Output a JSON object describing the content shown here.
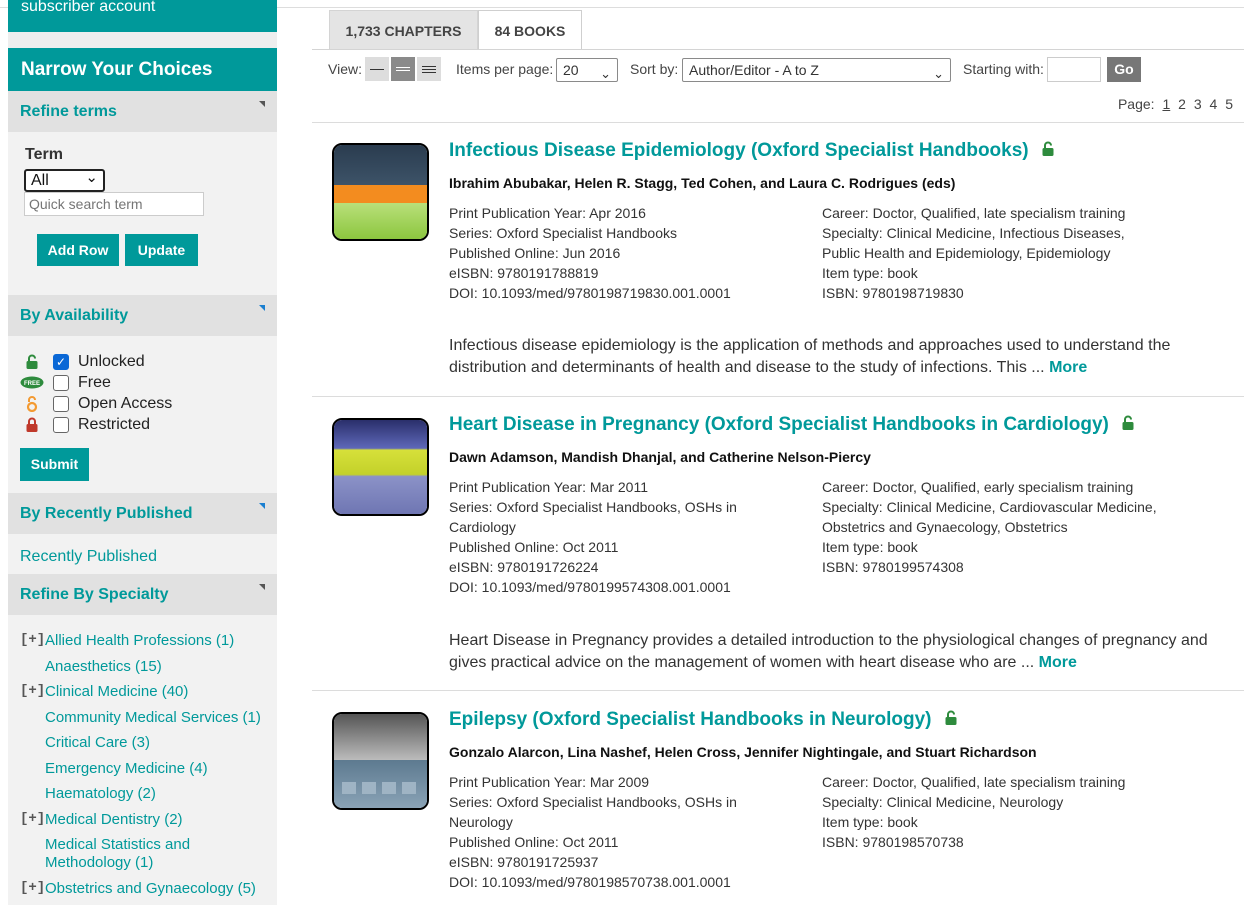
{
  "sidebar": {
    "subscriber_text": "subscriber account",
    "narrow_title": "Narrow Your Choices",
    "refine_terms": {
      "title": "Refine terms",
      "term_label": "Term",
      "term_value": "All",
      "search_placeholder": "Quick search term",
      "add_row": "Add Row",
      "update": "Update"
    },
    "availability": {
      "title": "By Availability",
      "options": [
        {
          "label": "Unlocked",
          "checked": true,
          "icon": "unlocked-icon"
        },
        {
          "label": "Free",
          "checked": false,
          "icon": "free-icon"
        },
        {
          "label": "Open Access",
          "checked": false,
          "icon": "open-access-icon"
        },
        {
          "label": "Restricted",
          "checked": false,
          "icon": "restricted-lock-icon"
        }
      ],
      "submit": "Submit"
    },
    "recent": {
      "title": "By Recently Published",
      "link": "Recently Published"
    },
    "specialty": {
      "title": "Refine By Specialty",
      "items": [
        {
          "label": "Allied Health Professions (1)",
          "expandable": true
        },
        {
          "label": "Anaesthetics (15)",
          "expandable": false
        },
        {
          "label": "Clinical Medicine (40)",
          "expandable": true
        },
        {
          "label": "Community Medical Services (1)",
          "expandable": false
        },
        {
          "label": "Critical Care (3)",
          "expandable": false
        },
        {
          "label": "Emergency Medicine (4)",
          "expandable": false
        },
        {
          "label": "Haematology (2)",
          "expandable": false
        },
        {
          "label": "Medical Dentistry (2)",
          "expandable": true
        },
        {
          "label": "Medical Statistics and Methodology (1)",
          "expandable": false
        },
        {
          "label": "Obstetrics and Gynaecology (5)",
          "expandable": true
        }
      ],
      "expand_glyph": "[+]"
    }
  },
  "tabs": [
    {
      "label": "1,733 CHAPTERS",
      "active": false
    },
    {
      "label": "84 BOOKS",
      "active": true
    }
  ],
  "controls": {
    "view_label": "View:",
    "items_label": "Items per page:",
    "items_value": "20",
    "sort_label": "Sort by:",
    "sort_value": "Author/Editor - A to Z",
    "starting_label": "Starting with:",
    "starting_value": "",
    "go": "Go",
    "chevron": "⌄"
  },
  "pager": {
    "label": "Page:",
    "pages": [
      "1",
      "2",
      "3",
      "4",
      "5"
    ],
    "current": "1"
  },
  "results": [
    {
      "title": "Infectious Disease Epidemiology (Oxford Specialist Handbooks)",
      "authors": "Ibrahim Abubakar, Helen R. Stagg, Ted Cohen, and Laura C. Rodrigues (eds)",
      "left_meta": [
        "Print Publication Year: Apr 2016",
        "Series: Oxford Specialist Handbooks",
        "Published Online: Jun 2016",
        "eISBN: 9780191788819",
        "DOI: 10.1093/med/9780198719830.001.0001"
      ],
      "right_meta": [
        "Career: Doctor, Qualified, late specialism training",
        "Specialty: Clinical Medicine, Infectious Diseases, Public Health and Epidemiology, Epidemiology",
        "Item type: book",
        "ISBN: 9780198719830"
      ],
      "abstract": "Infectious disease epidemiology is the application of methods and approaches used to understand the distribution and determinants of health and disease to the study of infections. This ...",
      "more": "More"
    },
    {
      "title": "Heart Disease in Pregnancy (Oxford Specialist Handbooks in Cardiology)",
      "authors": "Dawn Adamson, Mandish Dhanjal, and Catherine Nelson-Piercy",
      "left_meta": [
        "Print Publication Year: Mar 2011",
        "Series: Oxford Specialist Handbooks, OSHs in Cardiology",
        "Published Online: Oct 2011",
        "eISBN: 9780191726224",
        "DOI: 10.1093/med/9780199574308.001.0001"
      ],
      "right_meta": [
        "Career: Doctor, Qualified, early specialism training",
        "Specialty: Clinical Medicine, Cardiovascular Medicine, Obstetrics and Gynaecology, Obstetrics",
        "Item type: book",
        "ISBN: 9780199574308"
      ],
      "abstract": "Heart Disease in Pregnancy provides a detailed introduction to the physiological changes of pregnancy and gives practical advice on the management of women with heart disease who are ...",
      "more": "More"
    },
    {
      "title": "Epilepsy (Oxford Specialist Handbooks in Neurology)",
      "authors": "Gonzalo Alarcon, Lina Nashef, Helen Cross, Jennifer Nightingale, and Stuart Richardson",
      "left_meta": [
        "Print Publication Year: Mar 2009",
        "Series: Oxford Specialist Handbooks, OSHs in Neurology",
        "Published Online: Oct 2011",
        "eISBN: 9780191725937",
        "DOI: 10.1093/med/9780198570738.001.0001"
      ],
      "right_meta": [
        "Career: Doctor, Qualified, late specialism training",
        "Specialty: Clinical Medicine, Neurology",
        "Item type: book",
        "ISBN: 9780198570738"
      ]
    }
  ],
  "colors": {
    "accent": "#00999a",
    "lock_green": "#2e8b3d"
  }
}
